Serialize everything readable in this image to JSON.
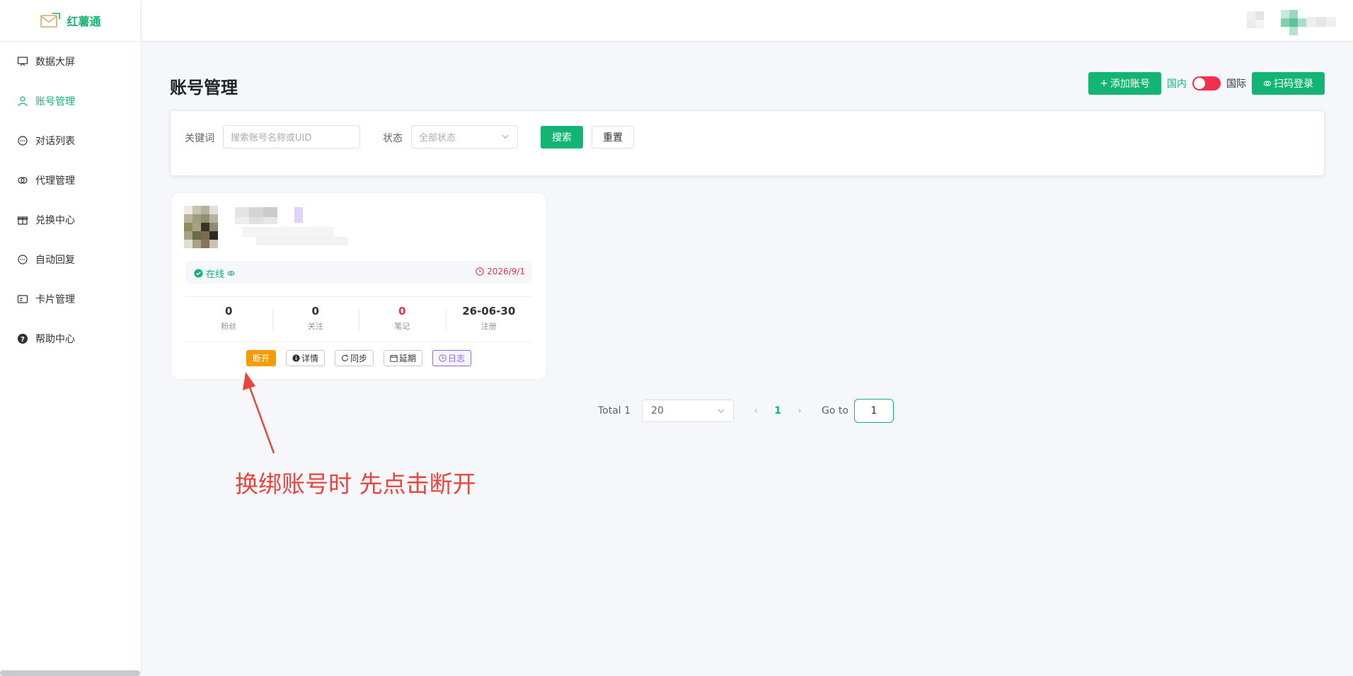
{
  "app": {
    "name": "红薯通"
  },
  "sidebar": {
    "items": [
      {
        "label": "数据大屏",
        "icon": "screen-icon",
        "active": false
      },
      {
        "label": "账号管理",
        "icon": "user-icon",
        "active": true
      },
      {
        "label": "对话列表",
        "icon": "chat-icon",
        "active": false
      },
      {
        "label": "代理管理",
        "icon": "link-icon",
        "active": false
      },
      {
        "label": "兑换中心",
        "icon": "gift-icon",
        "active": false
      },
      {
        "label": "自动回复",
        "icon": "reply-icon",
        "active": false
      },
      {
        "label": "卡片管理",
        "icon": "card-icon",
        "active": false
      },
      {
        "label": "帮助中心",
        "icon": "help-icon",
        "active": false
      }
    ]
  },
  "page": {
    "title": "账号管理",
    "add_account": "添加账号",
    "domestic": "国内",
    "international": "国际",
    "scan_login": "扫码登录"
  },
  "filter": {
    "keyword_label": "关键词",
    "keyword_placeholder": "搜索账号名称或UID",
    "status_label": "状态",
    "status_placeholder": "全部状态",
    "search": "搜索",
    "reset": "重置"
  },
  "account": {
    "status": "在线",
    "expire_date": "2026/9/1",
    "stats": [
      {
        "value": "0",
        "label": "粉丝"
      },
      {
        "value": "0",
        "label": "关注"
      },
      {
        "value": "0",
        "label": "笔记"
      },
      {
        "value": "26-06-30",
        "label": "注册"
      }
    ],
    "actions": {
      "disconnect": "断开",
      "detail": "详情",
      "sync": "同步",
      "extend": "延期",
      "log": "日志"
    }
  },
  "pagination": {
    "total": "Total 1",
    "page_size": "20",
    "current_page": "1",
    "goto_label": "Go to",
    "goto_value": "1"
  },
  "annotation": {
    "text": "换绑账号时 先点击断开"
  },
  "colors": {
    "primary": "#13b574",
    "danger": "#f0304d",
    "warning": "#f59c00",
    "purple": "#8c6be0",
    "annotation": "#e8453c"
  }
}
